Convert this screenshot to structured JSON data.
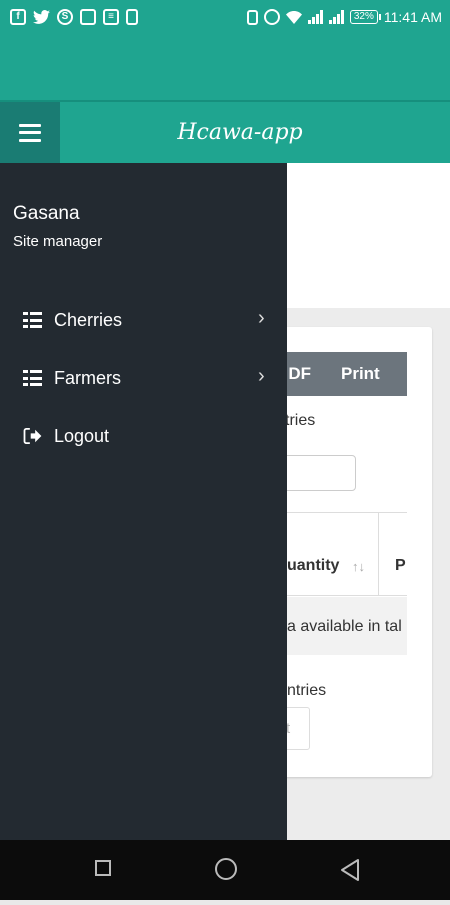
{
  "status_bar": {
    "time": "11:41 AM",
    "battery": "32%",
    "left_icons": [
      "facebook-icon",
      "twitter-icon",
      "shazam-icon",
      "gallery-icon",
      "news-icon",
      "sim-icon"
    ],
    "right_icons": [
      "vibrate-icon",
      "alarm-icon",
      "wifi-icon",
      "signal-icon",
      "signal-icon",
      "battery-icon"
    ]
  },
  "navbar": {
    "brand": "Hcawa-app",
    "menu_icon": "hamburger-icon"
  },
  "drawer": {
    "user_name": "Gasana",
    "user_role": "Site manager",
    "items": [
      {
        "label": "Cherries",
        "icon": "list-icon",
        "has_submenu": true
      },
      {
        "label": "Farmers",
        "icon": "list-icon",
        "has_submenu": true
      },
      {
        "label": "Logout",
        "icon": "logout-icon",
        "has_submenu": false
      }
    ],
    "chevron": "›"
  },
  "background_page": {
    "export_buttons": [
      "DF",
      "Print"
    ],
    "entries_label": "tries",
    "column_quantity": "uantity",
    "sort_glyph": "↑↓",
    "column_next": "P",
    "empty_message": "a available in tal",
    "info_label": "ntries",
    "pagination_fragment": "t"
  },
  "colors": {
    "primary": "#1fa590",
    "toggle_bg": "#1a7c73",
    "drawer_bg": "#232a31",
    "button_grey": "#6c757d"
  }
}
